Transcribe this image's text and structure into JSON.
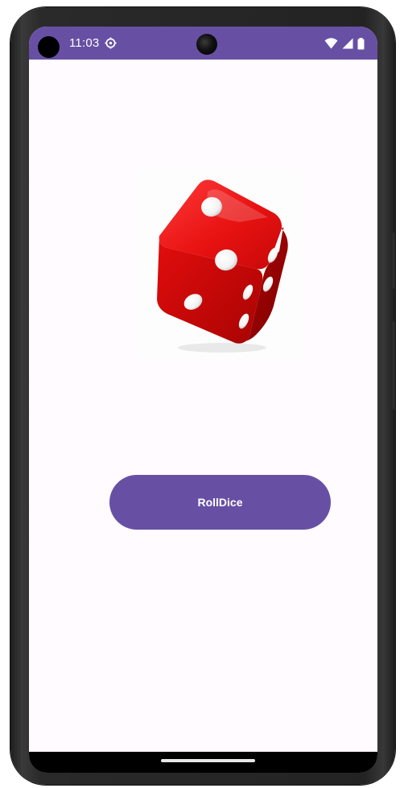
{
  "status_bar": {
    "time": "11:03",
    "icons": [
      "settings-icon",
      "wifi-icon",
      "signal-icon",
      "battery-icon"
    ],
    "background": "#6750a4"
  },
  "main": {
    "dice": {
      "icon": "dice-icon",
      "color": "#d10a0a"
    },
    "roll_button": {
      "label": "RollDice",
      "color": "#6750a4"
    }
  },
  "nav_bar": {
    "icon": "home-indicator"
  }
}
